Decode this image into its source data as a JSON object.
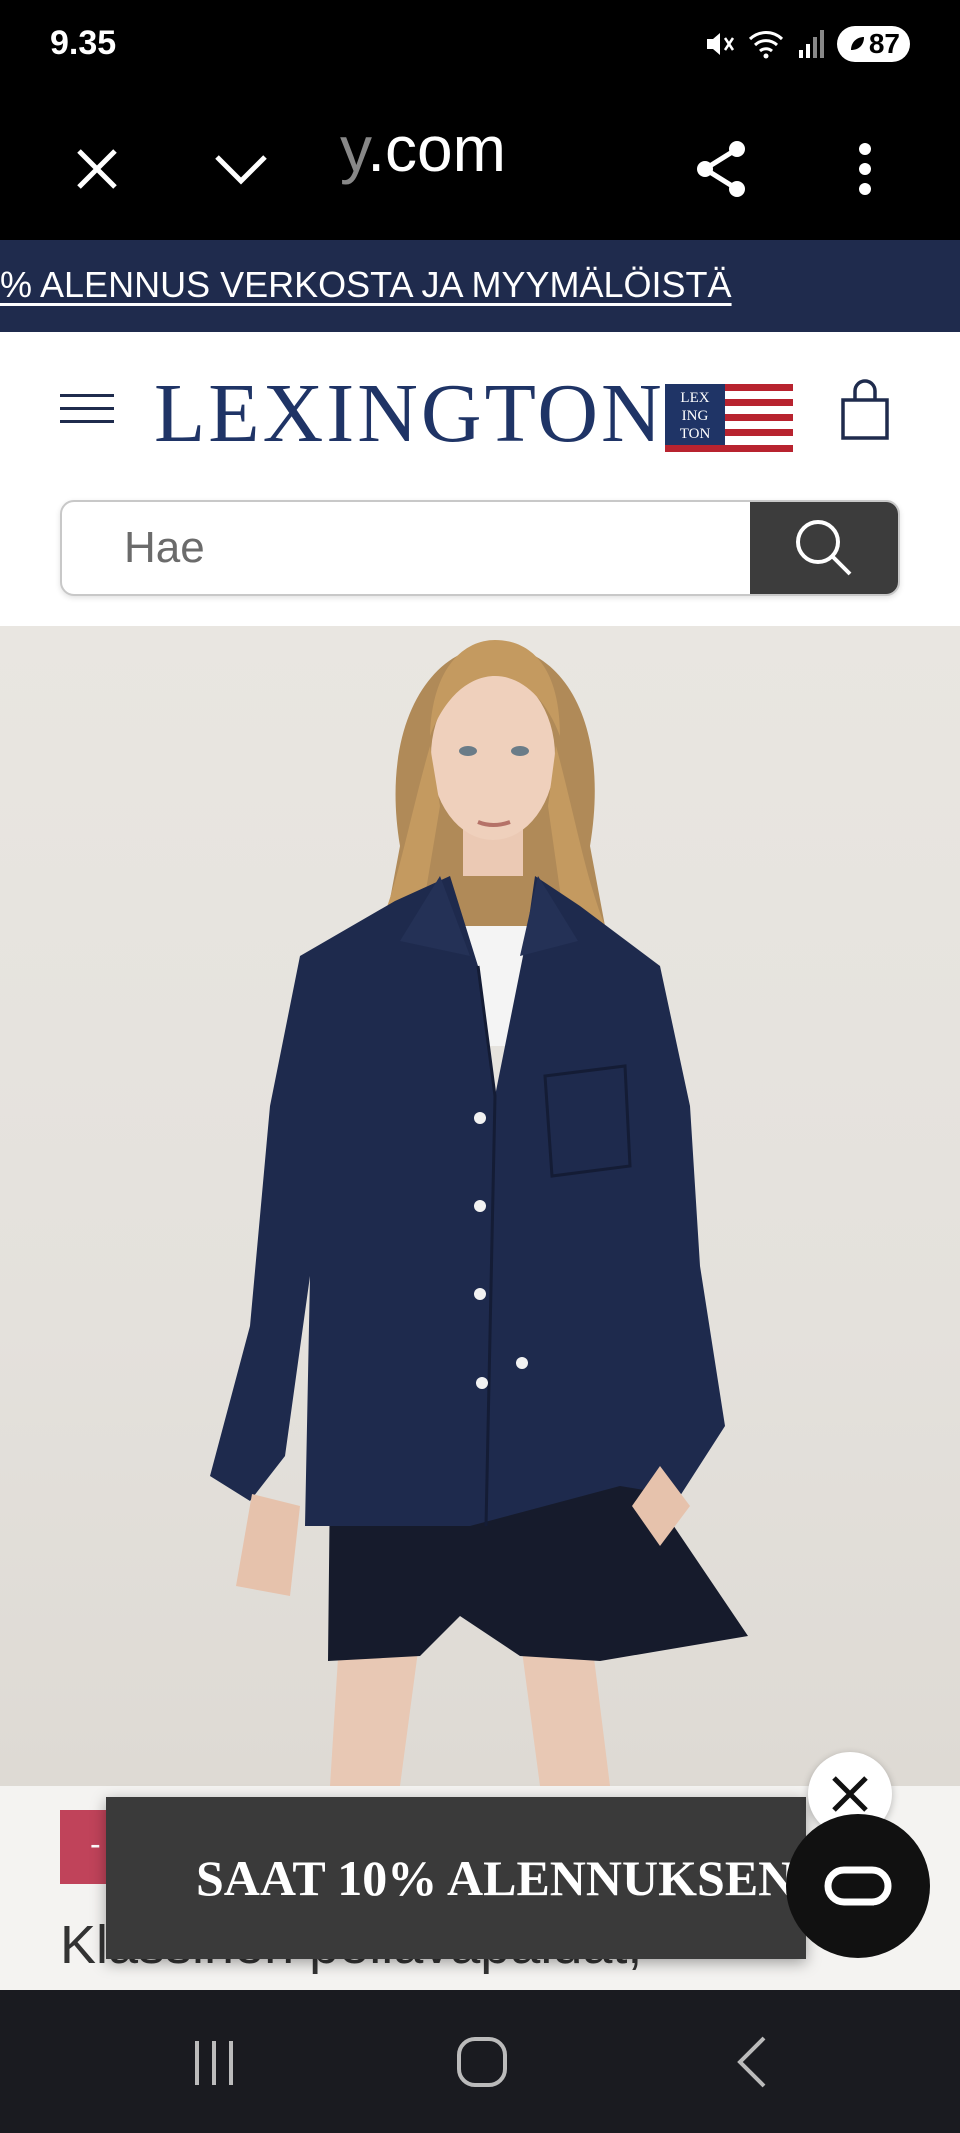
{
  "status_bar": {
    "time": "9.35",
    "battery": "87"
  },
  "browser": {
    "url_visible": ".com",
    "url_faded": "y",
    "icons": [
      "close-icon",
      "chevron-down-icon",
      "share-icon",
      "more-vert-icon"
    ]
  },
  "promo": {
    "text": "% ALENNUS VERKOSTA JA MYYMÄLÖISTÄ"
  },
  "header": {
    "logo": "LEXINGTON",
    "flag_text": [
      "LEX",
      "ING",
      "TON"
    ],
    "icons": [
      "menu-icon",
      "shopping-bag-icon"
    ]
  },
  "search": {
    "placeholder": "Hae"
  },
  "product": {
    "badge": "-",
    "name": "Klassinen pellavapaidat,"
  },
  "toast": {
    "text": "SAAT 10% ALENNUKSEN"
  },
  "colors": {
    "navy": "#1f2b4d",
    "logo_blue": "#1f3466",
    "flag_red": "#b8232f",
    "badge_red": "#c0435a"
  }
}
